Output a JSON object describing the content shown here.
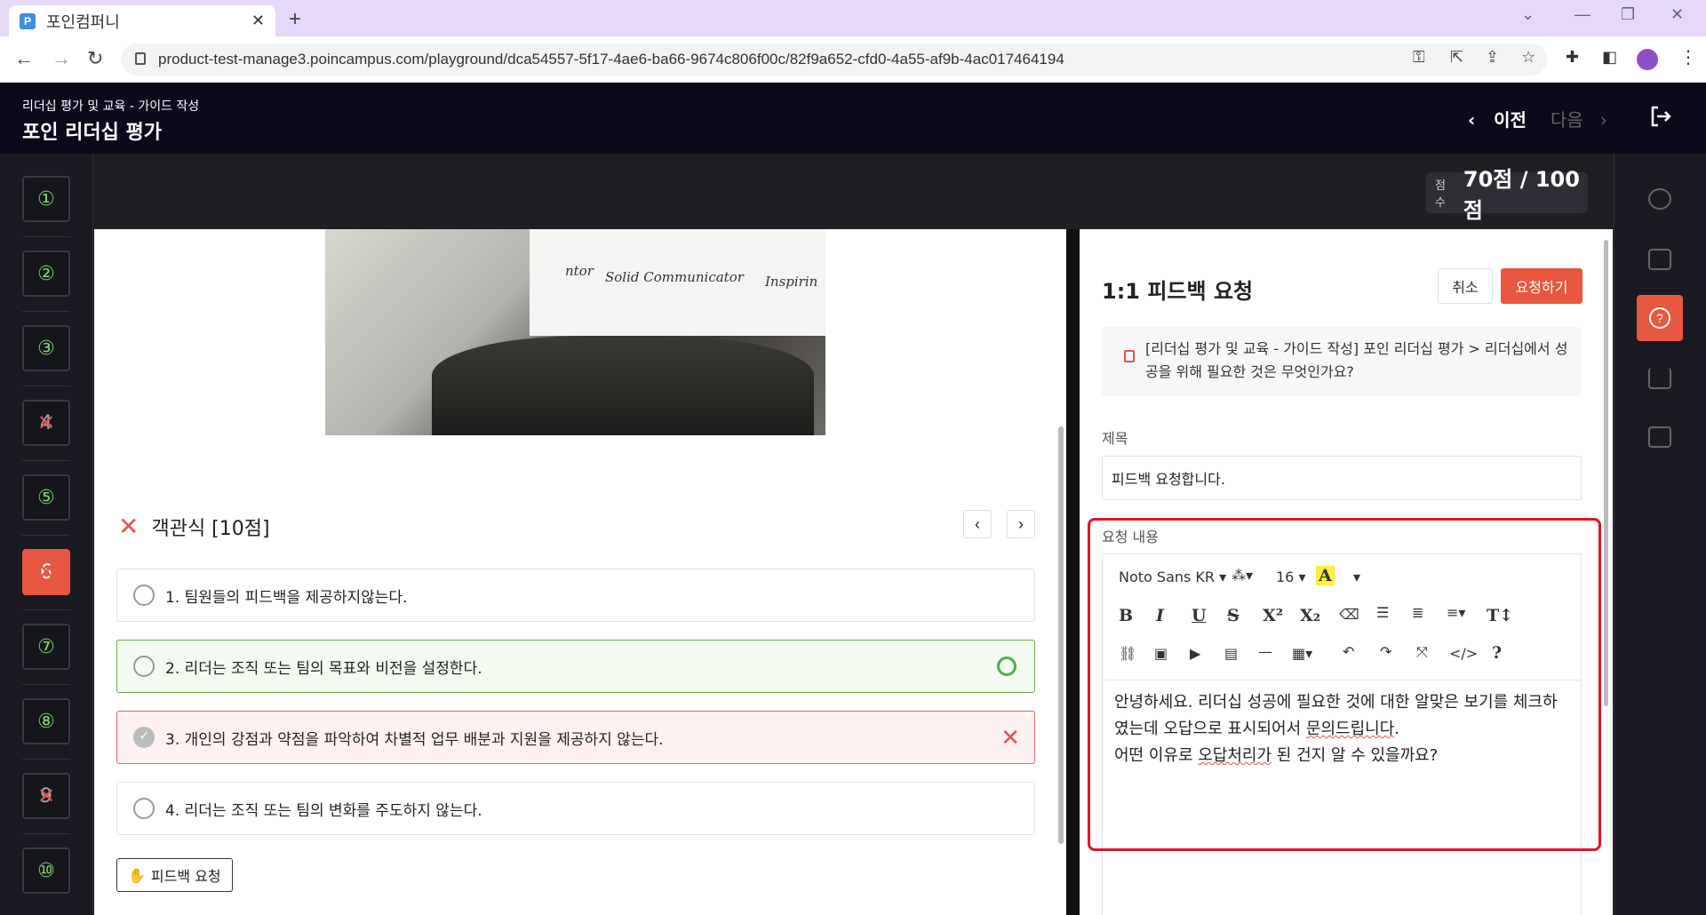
{
  "browser": {
    "tab_title": "포인컴퍼니",
    "favicon_letter": "P",
    "url": "product-test-manage3.poincampus.com/playground/dca54557-5f17-4ae6-ba66-9674c806f00c/82f9a652-cfd0-4a55-af9b-4ac017464194"
  },
  "header": {
    "subtitle": "리더십 평가 및 교육 - 가이드 작성",
    "title": "포인 리더십 평가",
    "prev_label": "이전",
    "next_label": "다음"
  },
  "nav": {
    "questions": [
      {
        "label": "①",
        "status": "correct"
      },
      {
        "label": "②",
        "status": "correct"
      },
      {
        "label": "③",
        "status": "correct"
      },
      {
        "label": "4",
        "status": "wrong"
      },
      {
        "label": "⑤",
        "status": "correct"
      },
      {
        "label": "6",
        "status": "active"
      },
      {
        "label": "⑦",
        "status": "correct"
      },
      {
        "label": "⑧",
        "status": "correct"
      },
      {
        "label": "9",
        "status": "wrong"
      },
      {
        "label": "⑩",
        "status": "correct"
      }
    ]
  },
  "score": {
    "label": "점수",
    "value": "70점 / 100점"
  },
  "photo": {
    "texts": [
      "Solid Communicator",
      "Inspirin",
      "ntor"
    ]
  },
  "question": {
    "type": "객관식 [10점]",
    "options": [
      "1. 팀원들의 피드백을 제공하지않는다.",
      "2. 리더는 조직 또는 팀의 목표와 비전을 설정한다.",
      "3. 개인의 강점과 약점을 파악하여 차별적 업무 배분과 지원을 제공하지 않는다.",
      "4. 리더는 조직 또는 팀의 변화를 주도하지 않는다."
    ],
    "feedback_button": "피드백 요청"
  },
  "feedback": {
    "title": "1:1 피드백 요청",
    "cancel": "취소",
    "submit": "요청하기",
    "context": "[리더십 평가 및 교육 - 가이드 작성] 포인 리더십 평가 > 리더십에서 성공을 위해 필요한 것은 무엇인가요?",
    "subject_label": "제목",
    "subject_value": "피드백 요청합니다.",
    "content_label": "요청 내용",
    "font_name": "Noto Sans KR",
    "font_size": "16",
    "body_line1": "안녕하세요. 리더십 성공에 필요한 것에 대한 알맞은 보기를 체크하였는데 오답으로 표시되어서 ",
    "body_word1": "문의드립니다",
    "body_line1_end": ".",
    "body_line2_start": "어떤 이유로 ",
    "body_word2": "오답처리가",
    "body_line2_end": " 된 건지 알 수 있을까요?"
  }
}
